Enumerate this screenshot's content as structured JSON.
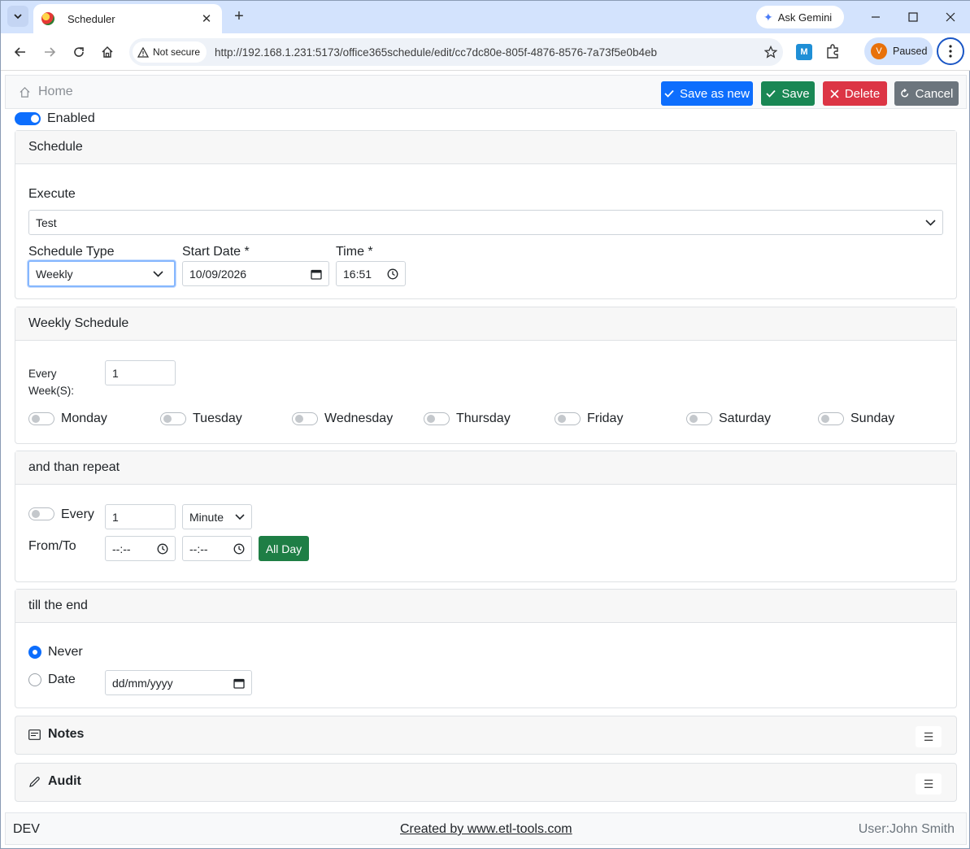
{
  "browser": {
    "tab_title": "Scheduler",
    "tab_close": "✕",
    "new_tab": "+",
    "gemini_label": "Ask Gemini",
    "security_label": "Not secure",
    "url": "http://192.168.1.231:5173/office365schedule/edit/cc7dc80e-805f-4876-8576-7a73f5e0b4eb",
    "extension_label": "M",
    "profile_initial": "V",
    "profile_status": "Paused"
  },
  "nav": {
    "home_label": "Home",
    "save_as_new_label": "Save as new",
    "save_label": "Save",
    "delete_label": "Delete",
    "cancel_label": "Cancel"
  },
  "enabled": {
    "label": "Enabled",
    "on": true
  },
  "schedule": {
    "header": "Schedule",
    "execute_label": "Execute",
    "execute_value": "Test",
    "type_label": "Schedule Type",
    "type_value": "Weekly",
    "start_date_label": "Start Date *",
    "start_date_value": "10/09/2026",
    "time_label": "Time *",
    "time_value": "16:51"
  },
  "weekly": {
    "header": "Weekly Schedule",
    "every_label_line1": "Every",
    "every_label_line2": "Week(S):",
    "every_value": "1",
    "days": [
      {
        "label": "Monday",
        "on": false
      },
      {
        "label": "Tuesday",
        "on": false
      },
      {
        "label": "Wednesday",
        "on": false
      },
      {
        "label": "Thursday",
        "on": false
      },
      {
        "label": "Friday",
        "on": false
      },
      {
        "label": "Saturday",
        "on": false
      },
      {
        "label": "Sunday",
        "on": false
      }
    ]
  },
  "repeat": {
    "header": "and than repeat",
    "every_label": "Every",
    "every_value": "1",
    "unit_value": "Minute",
    "from_to_label": "From/To",
    "from_value": "--:--",
    "to_value": "--:--",
    "all_day_label": "All Day"
  },
  "end": {
    "header": "till the end",
    "never_label": "Never",
    "date_label": "Date",
    "date_placeholder": "dd/mm/yyyy",
    "selected": "Never"
  },
  "notes": {
    "title": "Notes",
    "toggle": "☰"
  },
  "audit": {
    "title": "Audit",
    "toggle": "☰"
  },
  "footer": {
    "env": "DEV",
    "credit": "Created by www.etl-tools.com",
    "user": "User:John Smith"
  },
  "colors": {
    "primary": "#0d6efd",
    "success": "#198754",
    "danger": "#dc3545",
    "secondary": "#6c757d",
    "all_day": "#1e7e45"
  }
}
